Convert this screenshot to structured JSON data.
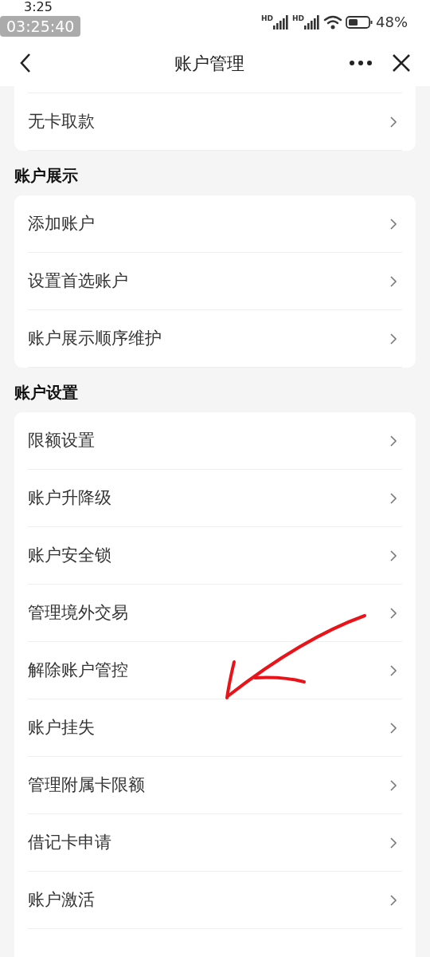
{
  "status_bar": {
    "time": "3:25",
    "recording_time": "03:25:40",
    "network_labels": [
      "HD",
      "HD"
    ],
    "battery": "48%"
  },
  "header": {
    "title": "账户管理"
  },
  "groups": [
    {
      "cut_off_above": true,
      "rows": [
        {
          "label": "无卡取款"
        }
      ]
    },
    {
      "title": "账户展示",
      "rows": [
        {
          "label": "添加账户"
        },
        {
          "label": "设置首选账户"
        },
        {
          "label": "账户展示顺序维护"
        }
      ]
    },
    {
      "title": "账户设置",
      "rows": [
        {
          "label": "限额设置"
        },
        {
          "label": "账户升降级"
        },
        {
          "label": "账户安全锁"
        },
        {
          "label": "管理境外交易"
        },
        {
          "label": "解除账户管控"
        },
        {
          "label": "账户挂失"
        },
        {
          "label": "管理附属卡限额"
        },
        {
          "label": "借记卡申请"
        },
        {
          "label": "账户激活"
        }
      ]
    }
  ]
}
